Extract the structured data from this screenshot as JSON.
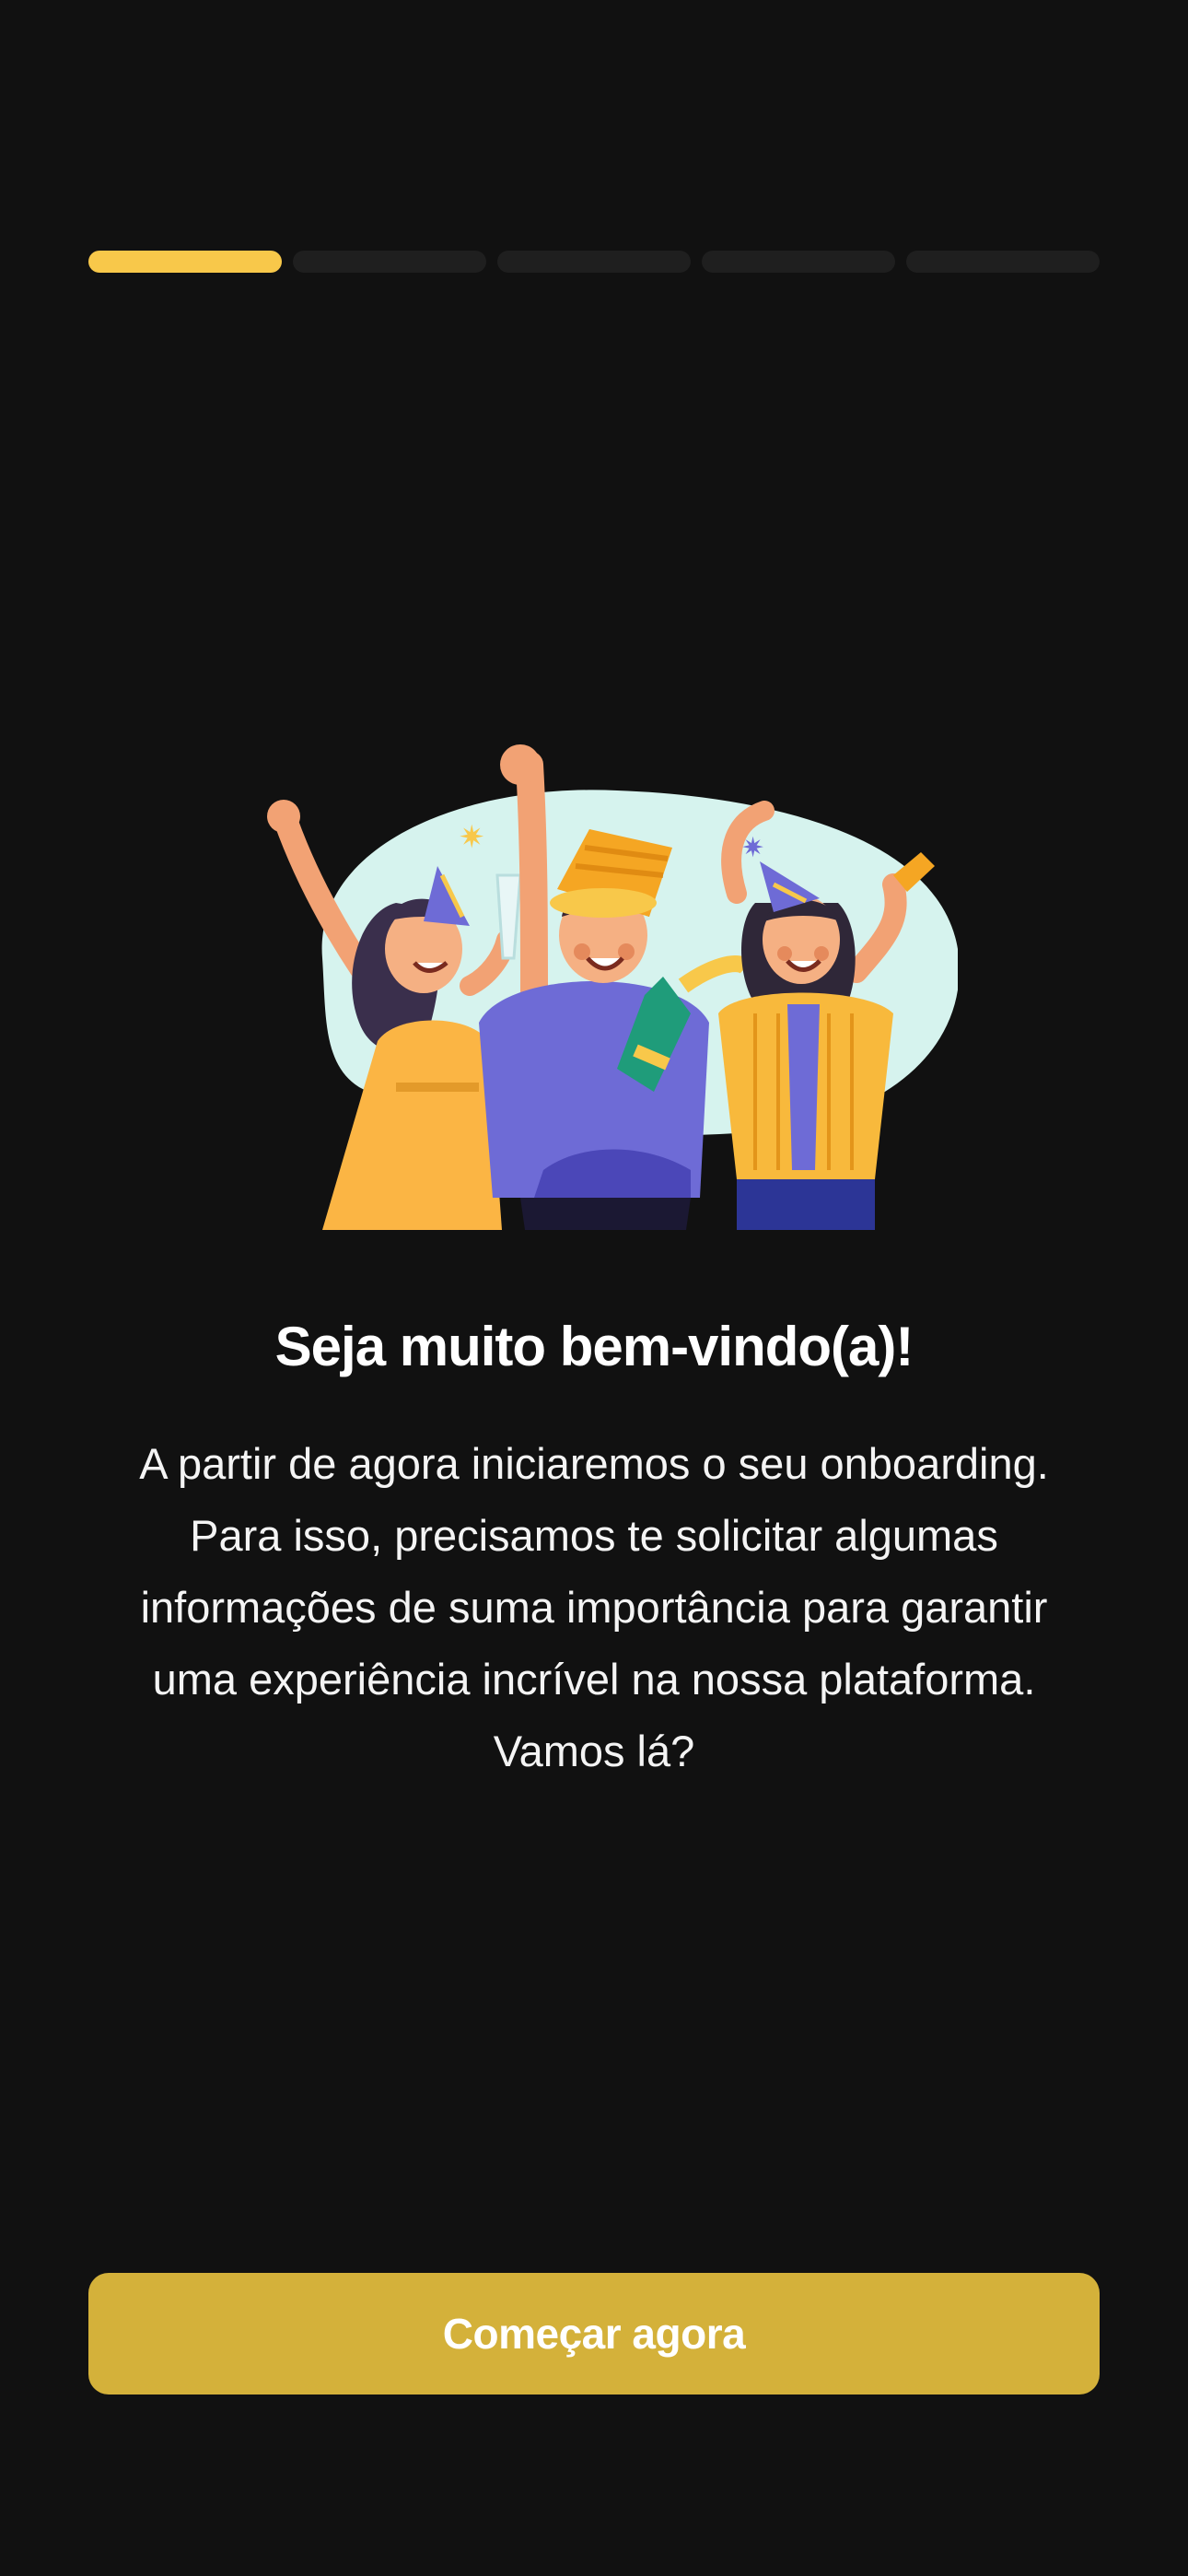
{
  "progress": {
    "total_steps": 5,
    "current_step": 1,
    "active_color": "#f8c84a",
    "inactive_color": "#1f1f1f"
  },
  "illustration": {
    "icon": "celebration-illustration",
    "background_color": "#d6f3ee"
  },
  "welcome": {
    "title": "Seja muito bem-vindo(a)!",
    "body": "A partir de agora iniciaremos o seu onboarding. Para isso, precisamos te solicitar algumas informações de suma importância para garantir uma experiência incrível na nossa plataforma. Vamos lá?"
  },
  "cta": {
    "label": "Começar agora",
    "color": "#d4b13a"
  },
  "theme": {
    "background": "#111111",
    "text": "#ffffff"
  }
}
